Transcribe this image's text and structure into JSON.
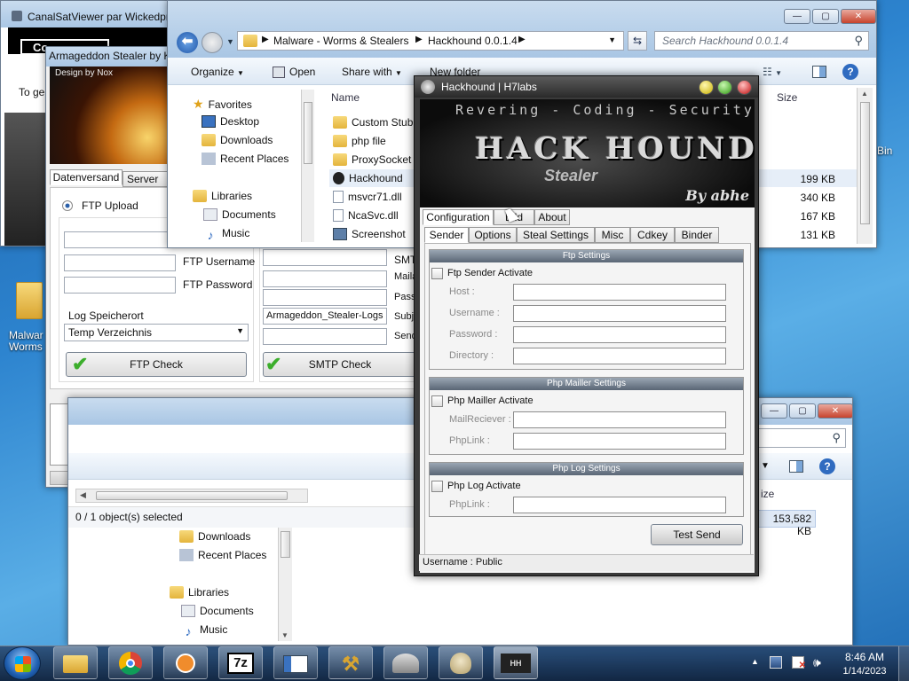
{
  "desktop": {
    "bin_label": "Bin",
    "folder_label_line1": "Malwar",
    "folder_label_line2": "Worms"
  },
  "canalsat": {
    "title": "CanalSatViewer par Wickedpra",
    "side_text": "To ge",
    "button_label": "Co"
  },
  "armageddon": {
    "title": "Armageddon Stealer by K",
    "banner_text": "Design by Nox",
    "tabs": [
      "Datenversand",
      "Server Se"
    ],
    "ftp_upload_label": "FTP Upload",
    "ftp_username_label": "FTP Username",
    "ftp_password_label": "FTP Password",
    "log_location_label": "Log Speicherort",
    "log_location_value": "Temp Verzeichnis",
    "smtp_labels": [
      "SMT",
      "Maila",
      "Pass",
      "Subje",
      "Send"
    ],
    "subject_value": "Armageddon_Stealer-Logs",
    "ftp_check_label": "FTP Check",
    "smtp_check_label": "SMTP Check"
  },
  "explorer_back": {
    "status": "0 / 1 object(s) selected",
    "size_header": "ize",
    "size_value": "153,582 KB",
    "tree": [
      "Downloads",
      "Recent Places",
      "Libraries",
      "Documents",
      "Music"
    ]
  },
  "explorer": {
    "breadcrumb": [
      "Malware - Worms & Stealers",
      "Hackhound 0.0.1.4"
    ],
    "search_placeholder": "Search Hackhound 0.0.1.4",
    "toolbar": {
      "organize": "Organize",
      "open": "Open",
      "share": "Share with",
      "new_folder": "New folder"
    },
    "tree": [
      "Favorites",
      "Desktop",
      "Downloads",
      "Recent Places",
      "Libraries",
      "Documents",
      "Music"
    ],
    "columns": {
      "name": "Name",
      "size": "Size"
    },
    "files": [
      {
        "name": "Custom Stub",
        "size": ""
      },
      {
        "name": "php file",
        "size": ""
      },
      {
        "name": "ProxySocket",
        "size": ""
      },
      {
        "name": "Hackhound",
        "size": "199 KB"
      },
      {
        "name": "msvcr71.dll",
        "size": "340 KB"
      },
      {
        "name": "NcaSvc.dll",
        "size": "167 KB"
      },
      {
        "name": "Screenshot",
        "size": "131 KB"
      }
    ]
  },
  "hackhound": {
    "title": "Hackhound | H7labs",
    "banner_top": "Revering - Coding - Security",
    "banner_logo": "HACK HOUND",
    "banner_sub": "Stealer",
    "banner_by": "By abhe",
    "main_tabs": [
      "Configuration",
      "Bild",
      "About"
    ],
    "sub_tabs": [
      "Sender",
      "Options",
      "Steal Settings",
      "Misc",
      "Cdkey",
      "Binder"
    ],
    "ftp": {
      "header": "Ftp Settings",
      "activate": "Ftp Sender Activate",
      "host": "Host :",
      "username": "Username :",
      "password": "Password :",
      "directory": "Directory :"
    },
    "php_mailer": {
      "header": "Php Mailler Settings",
      "activate": "Php Mailler Activate",
      "receiver": "MailReciever :",
      "link": "PhpLink :"
    },
    "php_log": {
      "header": "Php Log Settings",
      "activate": "Php Log Activate",
      "link": "PhpLink :"
    },
    "test_send": "Test Send",
    "status": "Username : Public"
  },
  "taskbar": {
    "time": "8:46 AM",
    "date": "1/14/2023",
    "seven_zip": "7z"
  }
}
